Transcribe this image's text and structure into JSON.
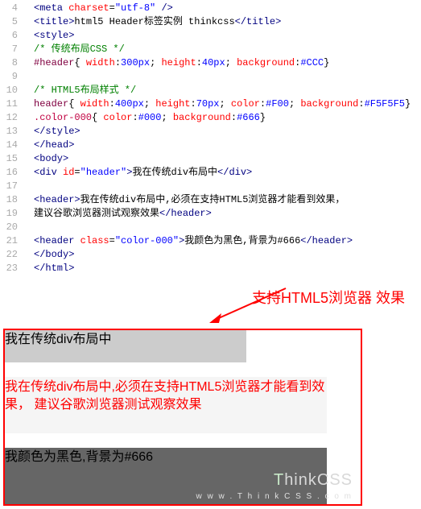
{
  "editor": {
    "lines": [
      {
        "n": "4",
        "tokens": [
          {
            "c": "t-tag",
            "t": "<meta"
          },
          {
            "c": "t-txt",
            "t": " "
          },
          {
            "c": "t-attr",
            "t": "charset"
          },
          {
            "c": "t-txt",
            "t": "="
          },
          {
            "c": "t-val",
            "t": "\"utf-8\""
          },
          {
            "c": "t-txt",
            "t": " "
          },
          {
            "c": "t-tag",
            "t": "/>"
          }
        ]
      },
      {
        "n": "5",
        "tokens": [
          {
            "c": "t-tag",
            "t": "<title>"
          },
          {
            "c": "t-txt",
            "t": "html5 Header标签实例 thinkcss"
          },
          {
            "c": "t-tag",
            "t": "</title>"
          }
        ]
      },
      {
        "n": "6",
        "tokens": [
          {
            "c": "t-tag",
            "t": "<style>"
          }
        ]
      },
      {
        "n": "7",
        "tokens": [
          {
            "c": "t-comment",
            "t": "/* 传统布局CSS */"
          }
        ]
      },
      {
        "n": "8",
        "tokens": [
          {
            "c": "t-sel",
            "t": "#header"
          },
          {
            "c": "t-txt",
            "t": "{ "
          },
          {
            "c": "t-prop",
            "t": "width"
          },
          {
            "c": "t-txt",
            "t": ":"
          },
          {
            "c": "t-pval",
            "t": "300px"
          },
          {
            "c": "t-txt",
            "t": "; "
          },
          {
            "c": "t-prop",
            "t": "height"
          },
          {
            "c": "t-txt",
            "t": ":"
          },
          {
            "c": "t-pval",
            "t": "40px"
          },
          {
            "c": "t-txt",
            "t": "; "
          },
          {
            "c": "t-prop",
            "t": "background"
          },
          {
            "c": "t-txt",
            "t": ":"
          },
          {
            "c": "t-pval",
            "t": "#CCC"
          },
          {
            "c": "t-txt",
            "t": "}"
          }
        ]
      },
      {
        "n": "9",
        "tokens": []
      },
      {
        "n": "10",
        "tokens": [
          {
            "c": "t-comment",
            "t": "/* HTML5布局样式 */"
          }
        ]
      },
      {
        "n": "11",
        "tokens": [
          {
            "c": "t-sel",
            "t": "header"
          },
          {
            "c": "t-txt",
            "t": "{ "
          },
          {
            "c": "t-prop",
            "t": "width"
          },
          {
            "c": "t-txt",
            "t": ":"
          },
          {
            "c": "t-pval",
            "t": "400px"
          },
          {
            "c": "t-txt",
            "t": "; "
          },
          {
            "c": "t-prop",
            "t": "height"
          },
          {
            "c": "t-txt",
            "t": ":"
          },
          {
            "c": "t-pval",
            "t": "70px"
          },
          {
            "c": "t-txt",
            "t": "; "
          },
          {
            "c": "t-prop",
            "t": "color"
          },
          {
            "c": "t-txt",
            "t": ":"
          },
          {
            "c": "t-pval",
            "t": "#F00"
          },
          {
            "c": "t-txt",
            "t": "; "
          },
          {
            "c": "t-prop",
            "t": "background"
          },
          {
            "c": "t-txt",
            "t": ":"
          },
          {
            "c": "t-pval",
            "t": "#F5F5F5"
          },
          {
            "c": "t-txt",
            "t": "}"
          }
        ]
      },
      {
        "n": "12",
        "tokens": [
          {
            "c": "t-selc",
            "t": ".color-000"
          },
          {
            "c": "t-txt",
            "t": "{ "
          },
          {
            "c": "t-prop",
            "t": "color"
          },
          {
            "c": "t-txt",
            "t": ":"
          },
          {
            "c": "t-pval",
            "t": "#000"
          },
          {
            "c": "t-txt",
            "t": "; "
          },
          {
            "c": "t-prop",
            "t": "background"
          },
          {
            "c": "t-txt",
            "t": ":"
          },
          {
            "c": "t-pval",
            "t": "#666"
          },
          {
            "c": "t-txt",
            "t": "}"
          }
        ]
      },
      {
        "n": "13",
        "tokens": [
          {
            "c": "t-tag",
            "t": "</style>"
          }
        ]
      },
      {
        "n": "14",
        "tokens": [
          {
            "c": "t-tag",
            "t": "</head>"
          }
        ]
      },
      {
        "n": "15",
        "tokens": [
          {
            "c": "t-tag",
            "t": "<body>"
          }
        ]
      },
      {
        "n": "16",
        "tokens": [
          {
            "c": "t-tag",
            "t": "<div"
          },
          {
            "c": "t-txt",
            "t": " "
          },
          {
            "c": "t-attr",
            "t": "id"
          },
          {
            "c": "t-txt",
            "t": "="
          },
          {
            "c": "t-val",
            "t": "\"header\""
          },
          {
            "c": "t-tag",
            "t": ">"
          },
          {
            "c": "t-txt",
            "t": "我在传统div布局中"
          },
          {
            "c": "t-tag",
            "t": "</div>"
          }
        ]
      },
      {
        "n": "17",
        "tokens": []
      },
      {
        "n": "18",
        "tokens": [
          {
            "c": "t-tag",
            "t": "<header>"
          },
          {
            "c": "t-txt",
            "t": "我在传统div布局中,必须在支持HTML5浏览器才能看到效果，"
          }
        ]
      },
      {
        "n": "19",
        "tokens": [
          {
            "c": "t-txt",
            "t": "建议谷歌浏览器测试观察效果"
          },
          {
            "c": "t-tag",
            "t": "</header>"
          }
        ]
      },
      {
        "n": "20",
        "tokens": []
      },
      {
        "n": "21",
        "tokens": [
          {
            "c": "t-tag",
            "t": "<header"
          },
          {
            "c": "t-txt",
            "t": " "
          },
          {
            "c": "t-attr",
            "t": "class"
          },
          {
            "c": "t-txt",
            "t": "="
          },
          {
            "c": "t-val",
            "t": "\"color-000\""
          },
          {
            "c": "t-tag",
            "t": ">"
          },
          {
            "c": "t-txt",
            "t": "我颜色为黑色,背景为#666"
          },
          {
            "c": "t-tag",
            "t": "</header>"
          }
        ]
      },
      {
        "n": "22",
        "tokens": [
          {
            "c": "t-tag",
            "t": "</body>"
          }
        ]
      },
      {
        "n": "23",
        "tokens": [
          {
            "c": "t-tag",
            "t": "</html>"
          }
        ]
      }
    ]
  },
  "annotation": {
    "text": "支持HTML5浏览器 效果"
  },
  "output": {
    "box1": "我在传统div布局中",
    "box2": "我在传统div布局中,必须在支持HTML5浏览器才能看到效果， 建议谷歌浏览器测试观察效果",
    "box3": "我颜色为黑色,背景为#666"
  },
  "watermark": {
    "main_prefix": "T",
    "main_rest": "hinkCSS",
    "sub": "w w w . T h i n k C S S . c o m"
  }
}
